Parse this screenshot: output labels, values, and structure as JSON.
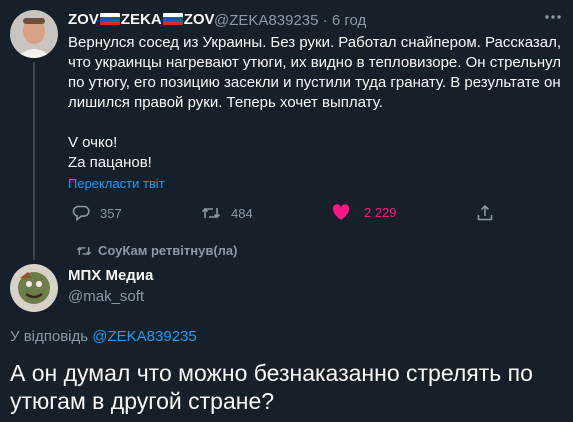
{
  "tweet1": {
    "display_name_parts": [
      "ZOV",
      "ZEKA",
      "ZOV"
    ],
    "handle": "@ZEKA839235",
    "separator": "·",
    "time": "6 год",
    "text_lines": [
      "Вернулся сосед из Украины. Без руки. Работал снайпером. Рассказал,",
      "что украинцы нагревают утюги, их видно в тепловизоре. Он стрельнул",
      "по утюгу, его позицию засекли и пустили туда гранату. В результате он",
      "лишился правой руки. Теперь хочет выплату."
    ],
    "text_lines_2": [
      "V очко!",
      "Za пацанов!"
    ],
    "translate_label": "Перекласти твіт",
    "replies": "357",
    "retweets": "484",
    "likes": "2 229",
    "icons": [
      "more-icon",
      "reply-icon",
      "retweet-icon",
      "heart-icon",
      "share-icon"
    ]
  },
  "retweet_context": {
    "label": "СоуКам ретвітнув(ла)"
  },
  "tweet2": {
    "display_name": "МПХ Медиа",
    "handle": "@mak_soft",
    "reply_prefix": "У відповідь",
    "reply_to": "@ZEKA839235",
    "text": "А он думал что можно безнаказанно стрелять по утюгам в другой стране?"
  },
  "colors": {
    "background": "#15202b",
    "text": "#f7f9f9",
    "muted": "#8b98a5",
    "link": "#1d9bf0",
    "like": "#f91880"
  }
}
